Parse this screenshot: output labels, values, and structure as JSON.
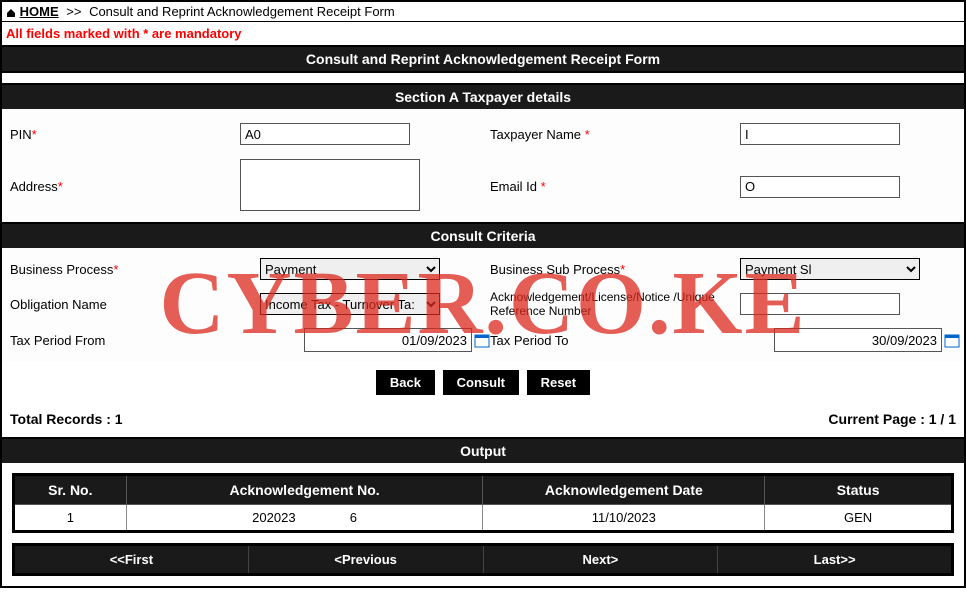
{
  "breadcrumb": {
    "home": "HOME",
    "sep": ">>",
    "current": "Consult and Reprint Acknowledgement Receipt Form"
  },
  "mandatory_note": "All fields marked with * are mandatory",
  "headers": {
    "title": "Consult and Reprint Acknowledgement Receipt Form",
    "section_a": "Section A Taxpayer details",
    "consult_criteria": "Consult Criteria",
    "output": "Output"
  },
  "taxpayer": {
    "pin_label": "PIN",
    "pin_value": "A0",
    "name_label": "Taxpayer Name ",
    "name_value": "I",
    "address_label": "Address",
    "address_value": "",
    "email_label": "Email Id ",
    "email_value": "O"
  },
  "criteria": {
    "bp_label": "Business Process",
    "bp_value": "Payment",
    "bsp_label": "Business Sub Process",
    "bsp_value": "Payment Sl",
    "obligation_label": "Obligation Name",
    "obligation_value": "Income Tax - Turnover Ta:",
    "ref_label": "Acknowledgement/License/Notice /Unique Reference Number",
    "ref_value": "",
    "period_from_label": "Tax Period From",
    "period_from_value": "01/09/2023",
    "period_to_label": "Tax Period To",
    "period_to_value": "30/09/2023"
  },
  "buttons": {
    "back": "Back",
    "consult": "Consult",
    "reset": "Reset"
  },
  "records": {
    "total_label": "Total Records : 1",
    "page_label": "Current Page : 1 / 1"
  },
  "table": {
    "headers": {
      "sr": "Sr. No.",
      "ack": "Acknowledgement No.",
      "date": "Acknowledgement Date",
      "status": "Status"
    },
    "row": {
      "sr": "1",
      "ack": "202023               6",
      "date": "11/10/2023",
      "status": "GEN"
    }
  },
  "pager": {
    "first": "<<First",
    "prev": "<Previous",
    "next": "Next>",
    "last": "Last>>"
  },
  "watermark": "CYBER.CO.KE"
}
